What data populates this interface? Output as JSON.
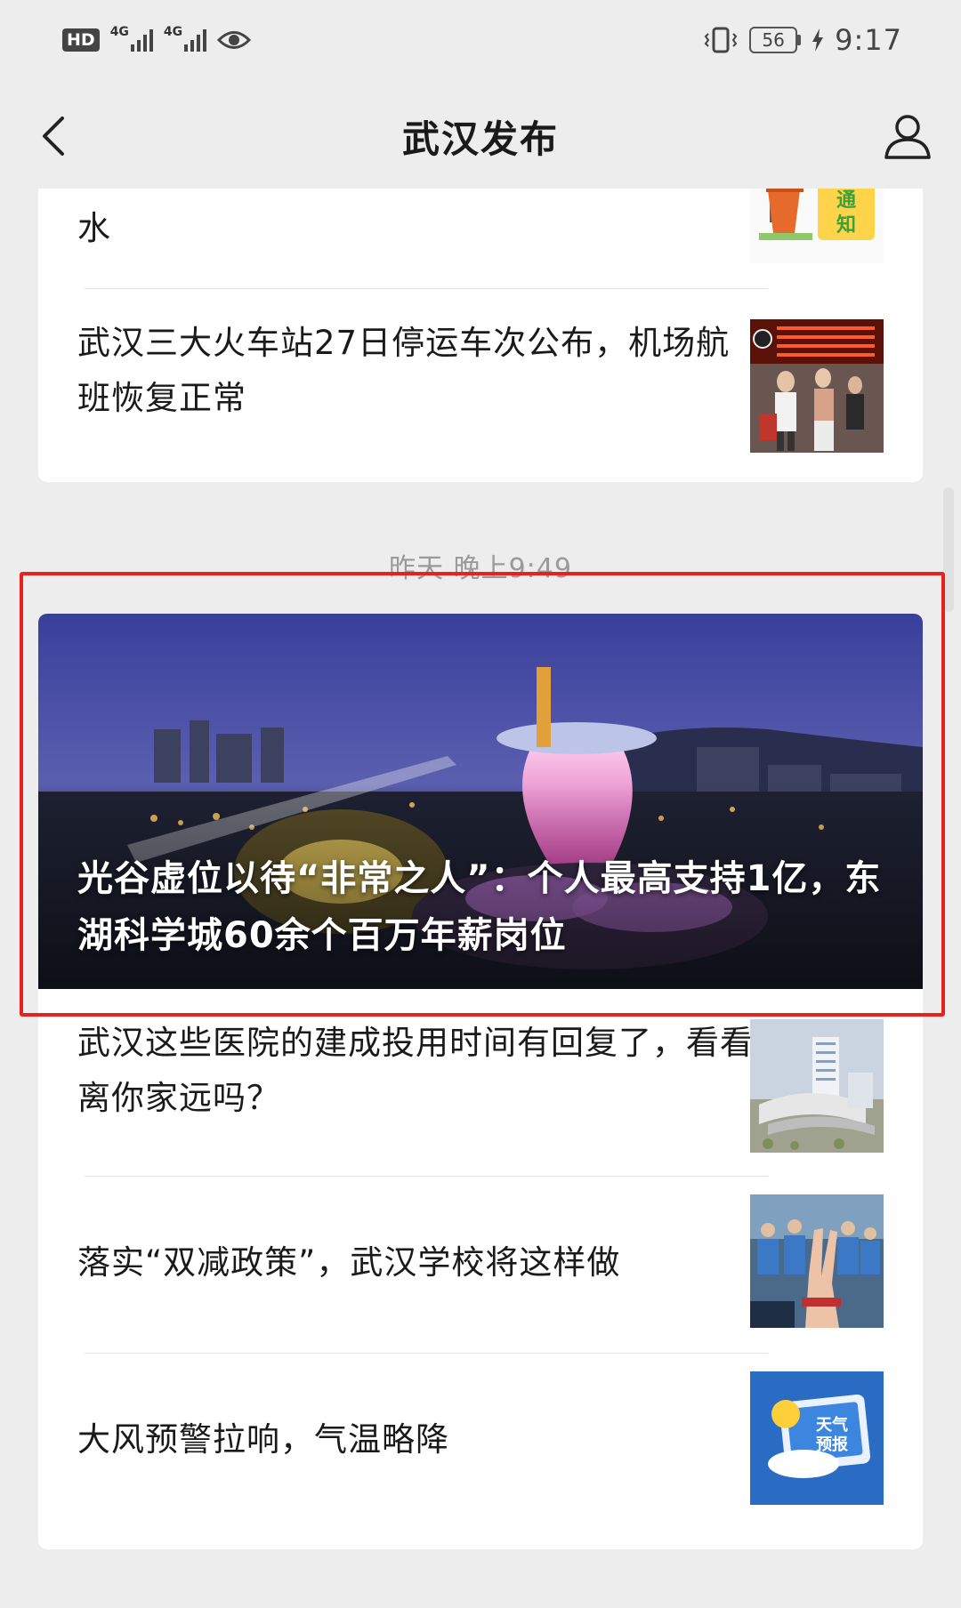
{
  "status_bar": {
    "hd": "HD",
    "net1": "4G",
    "net2": "4G",
    "battery": "56",
    "time": "9:17"
  },
  "nav": {
    "title": "武汉发布",
    "back_icon": "chevron-left-icon",
    "profile_icon": "user-icon"
  },
  "feed_top": {
    "items": [
      {
        "title": "水"
      },
      {
        "title": "武汉三大火车站27日停运车次公布，机场航班恢复正常"
      }
    ]
  },
  "timestamp": "昨天 晚上9:49",
  "feed_main": {
    "hero": {
      "title": "光谷虚位以待“非常之人”：个人最高支持1亿，东湖科学城60余个百万年薪岗位"
    },
    "items": [
      {
        "title": "武汉这些医院的建成投用时间有回复了，看看离你家远吗？"
      },
      {
        "title": "落实“双减政策”，武汉学校将这样做"
      },
      {
        "title": "大风预警拉响，气温略降"
      }
    ]
  },
  "thumb_labels": {
    "notice": "通知",
    "weather": "天气预报"
  },
  "colors": {
    "highlight": "#e8201e",
    "background": "#ededed",
    "card": "#ffffff"
  }
}
